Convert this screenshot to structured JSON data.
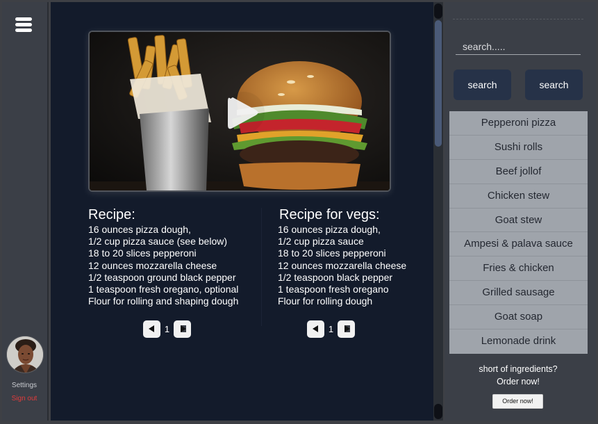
{
  "sidebar": {
    "menu_icon": "hamburger-menu-icon",
    "settings_label": "Settings",
    "signout_label": "Sign out",
    "signout_color": "#e23b3b"
  },
  "video": {
    "play_icon": "play-icon"
  },
  "recipes": [
    {
      "title": "Recipe:",
      "lines": [
        "16 ounces pizza dough,",
        "1/2 cup pizza sauce (see below)",
        "18 to 20 slices pepperoni",
        "12 ounces mozzarella cheese",
        "1/2 teaspoon ground black pepper",
        "1 teaspoon fresh oregano, optional",
        "Flour for rolling and shaping dough"
      ],
      "page": "1"
    },
    {
      "title": "Recipe for vegs:",
      "lines": [
        "16 ounces pizza dough,",
        "1/2 cup pizza sauce",
        "18 to 20 slices pepperoni",
        "12 ounces mozzarella cheese",
        "1/2 teaspoon black pepper",
        "1 teaspoon fresh oregano",
        "Flour for rolling dough"
      ],
      "page": "1"
    }
  ],
  "search": {
    "placeholder": "search.....",
    "button1_label": "search",
    "button2_label": "search"
  },
  "dishes": [
    "Pepperoni pizza",
    "Sushi rolls",
    "Beef jollof",
    "Chicken stew",
    "Goat stew",
    "Ampesi & palava sauce",
    "Fries & chicken",
    "Grilled sausage",
    "Goat soap",
    "Lemonade drink"
  ],
  "order": {
    "line1": "short of ingredients?",
    "line2": "Order now!",
    "button_label": "Order now!"
  }
}
